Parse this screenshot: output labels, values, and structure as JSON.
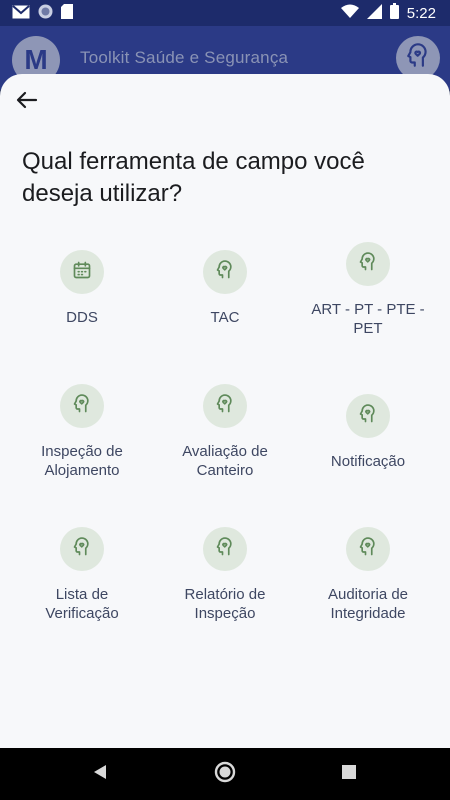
{
  "status_bar": {
    "time": "5:22",
    "icons": [
      "gmail-icon",
      "circle-app-icon",
      "sd-card-icon",
      "wifi-icon",
      "cell-signal-icon",
      "battery-icon"
    ]
  },
  "app_header": {
    "logo_letter": "M",
    "title": "Toolkit Saúde e Segurança",
    "action_icon": "head-heart-icon"
  },
  "sheet": {
    "back_icon": "arrow-left-icon",
    "title": "Qual ferramenta de campo você deseja utilizar?",
    "tools": [
      {
        "label": "DDS",
        "icon": "calendar-icon"
      },
      {
        "label": "TAC",
        "icon": "head-heart-icon"
      },
      {
        "label": "ART - PT - PTE - PET",
        "icon": "head-heart-icon"
      },
      {
        "label": "Inspeção de Alojamento",
        "icon": "head-heart-icon"
      },
      {
        "label": "Avaliação de Canteiro",
        "icon": "head-heart-icon"
      },
      {
        "label": "Notificação",
        "icon": "head-heart-icon"
      },
      {
        "label": "Lista de Verificação",
        "icon": "head-heart-icon"
      },
      {
        "label": "Relatório de Inspeção",
        "icon": "head-heart-icon"
      },
      {
        "label": "Auditoria de Integridade",
        "icon": "head-heart-icon"
      }
    ]
  },
  "nav_bar": {
    "buttons": [
      "back-triangle-icon",
      "home-circle-icon",
      "recents-square-icon"
    ]
  },
  "colors": {
    "status_bar": "#1d2b6b",
    "header": "#2b3a86",
    "sheet_bg": "#f7f8fa",
    "icon_circle": "#dfe8de",
    "icon_stroke": "#5f8a5a",
    "label_text": "#3e4762"
  }
}
